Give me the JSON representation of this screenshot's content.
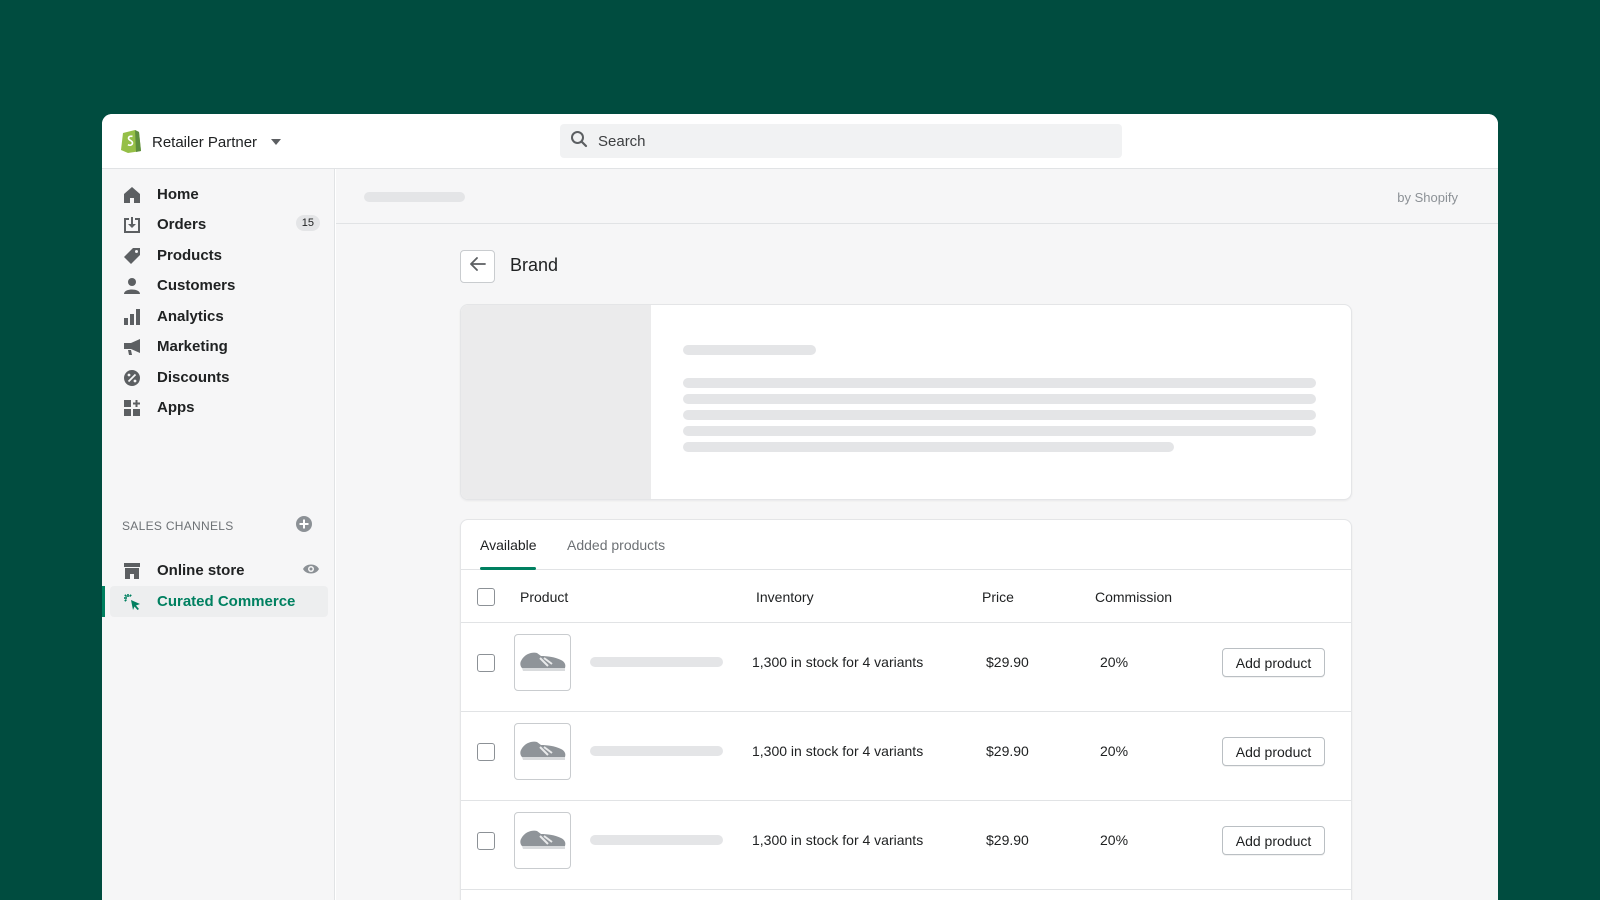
{
  "topbar": {
    "store_name": "Retailer Partner",
    "search_placeholder": "Search"
  },
  "sidebar": {
    "items": [
      {
        "label": "Home",
        "icon": "home-icon"
      },
      {
        "label": "Orders",
        "icon": "orders-icon",
        "badge": "15"
      },
      {
        "label": "Products",
        "icon": "tag-icon"
      },
      {
        "label": "Customers",
        "icon": "person-icon"
      },
      {
        "label": "Analytics",
        "icon": "bar-chart-icon"
      },
      {
        "label": "Marketing",
        "icon": "megaphone-icon"
      },
      {
        "label": "Discounts",
        "icon": "discount-icon"
      },
      {
        "label": "Apps",
        "icon": "apps-icon"
      }
    ],
    "sales_channels_title": "SALES CHANNELS",
    "channels": [
      {
        "label": "Online store",
        "icon": "store-icon"
      },
      {
        "label": "Curated Commerce",
        "icon": "sparkle-cursor-icon",
        "active": true
      }
    ]
  },
  "header": {
    "byline": "by Shopify"
  },
  "page": {
    "title": "Brand"
  },
  "products": {
    "tabs": [
      {
        "label": "Available",
        "active": true
      },
      {
        "label": "Added products",
        "active": false
      }
    ],
    "columns": [
      "Product",
      "Inventory",
      "Price",
      "Commission"
    ],
    "rows": [
      {
        "inventory": "1,300 in stock for 4 variants",
        "price": "$29.90",
        "commission": "20%",
        "action": "Add product"
      },
      {
        "inventory": "1,300 in stock for 4 variants",
        "price": "$29.90",
        "commission": "20%",
        "action": "Add product"
      },
      {
        "inventory": "1,300 in stock for 4 variants",
        "price": "$29.90",
        "commission": "20%",
        "action": "Add product"
      }
    ]
  },
  "colors": {
    "background": "#004c3f",
    "accent": "#008060",
    "sidebar_bg": "#f6f6f7"
  }
}
